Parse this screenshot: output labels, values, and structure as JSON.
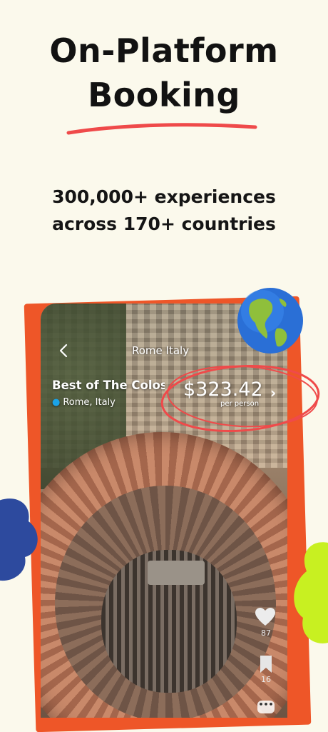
{
  "headline": {
    "line1": "On-Platform",
    "line2": "Booking"
  },
  "subheadline": {
    "line1": "300,000+ experiences",
    "line2": "across 170+ countries"
  },
  "app": {
    "nav_title": "Rome Italy",
    "back_icon": "chevron-left-icon",
    "tour": {
      "name": "Best of The Colosseum",
      "location": "Rome, Italy"
    },
    "price": {
      "amount": "$323.42",
      "unit": "per person"
    },
    "actions": {
      "likes": "87",
      "saves": "16"
    }
  },
  "colors": {
    "background": "#fbf9ec",
    "accent_orange": "#ee5628",
    "underline_red": "#ef4a4a",
    "blob_blue": "#2d4a9e",
    "blob_green": "#c8f021",
    "pin_blue": "#1aa3e8"
  }
}
